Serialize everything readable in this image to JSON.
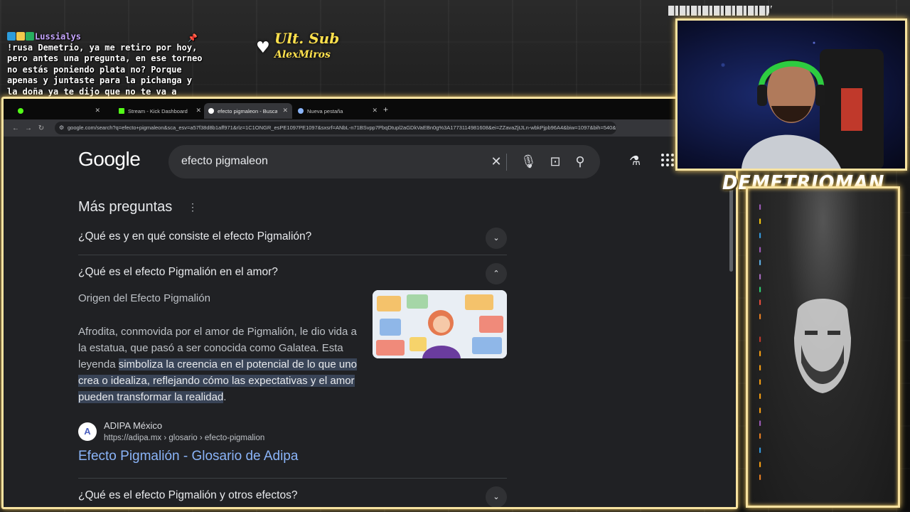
{
  "stream_overlay": {
    "top_chat": {
      "username": "Lussialys",
      "message": "!rusa Demetrio, ya me retiro por hoy, pero antes una pregunta, en ese torneo no estás poniendo plata no? Porque apenas y juntaste para la pichanga y la doña ya te dijo que no te va a volver a prestar"
    },
    "ult_sub": {
      "title": "Ult. Sub",
      "name": "AlexMiros"
    },
    "streamer_name": "DEMETRIOMAN",
    "colors": {
      "frame_glow": "#f7e2a0",
      "accent": "#ffd56b"
    }
  },
  "browser": {
    "tabs": [
      {
        "label": "",
        "favicon": "kick-icon"
      },
      {
        "label": "Stream - Kick Dashboard",
        "favicon": "kick-icon"
      },
      {
        "label": "efecto pigmaleon - Buscar con Google",
        "favicon": "google-icon",
        "active": true
      },
      {
        "label": "Nueva pestaña",
        "favicon": "chrome-icon"
      }
    ],
    "url": "google.com/search?q=efecto+pigmaleon&sca_esv=a57f38d8b1aff971&rlz=1C1ONGR_esPE1097PE1097&sxsrf=ANbL-n71BSvpp7PbqDtupl2aGDkVaEBn0g%3A1773114981608&ei=ZZavaZjtJLn-wbkPjpb96A4&biw=1097&bih=540&v..."
  },
  "google": {
    "logo": "Google",
    "query": "efecto pigmaleon",
    "more_questions_title": "Más preguntas",
    "questions": [
      "¿Qué es y en qué consiste el efecto Pigmalión?",
      "¿Qué es el efecto Pigmalión en el amor?",
      "¿Qué es el efecto Pigmalión y otros efectos?"
    ],
    "answer": {
      "heading": "Origen del Efecto Pigmalión",
      "text_before": "Afrodita, conmovida por el amor de Pigmalión, le dio vida a la estatua, que pasó a ser conocida como Galatea. Esta leyenda ",
      "highlight": "simboliza la creencia en el potencial de lo que uno crea o idealiza, reflejando cómo las expectativas y el amor pueden transformar la realidad",
      "text_after": "."
    },
    "source": {
      "name": "ADIPA México",
      "url": "https://adipa.mx › glosario › efecto-pigmalion",
      "title": "Efecto Pigmalión - Glosario de Adipa"
    }
  }
}
